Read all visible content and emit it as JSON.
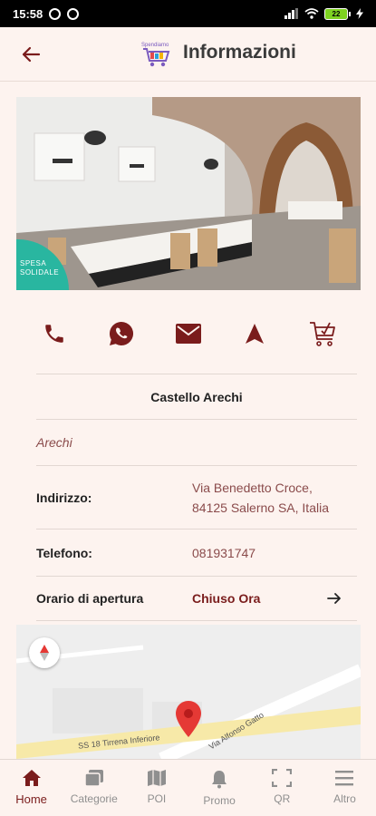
{
  "status_bar": {
    "time": "15:58",
    "battery": "22"
  },
  "app_bar": {
    "title": "Informazioni",
    "logo_text": "Spendiamo"
  },
  "hero": {
    "badge_line1": "SPESA",
    "badge_line2": "SOLIDALE"
  },
  "actions": [
    {
      "icon": "phone-icon"
    },
    {
      "icon": "whatsapp-icon"
    },
    {
      "icon": "email-icon"
    },
    {
      "icon": "navigation-icon"
    },
    {
      "icon": "shopping-cart-icon"
    }
  ],
  "place": {
    "name": "Castello Arechi",
    "city": "Arechi",
    "address_label": "Indirizzo:",
    "address_line1": "Via Benedetto Croce,",
    "address_line2": "84125 Salerno SA, Italia",
    "phone_label": "Telefono:",
    "phone_value": "081931747",
    "hours_label": "Orario di apertura",
    "hours_value": "Chiuso Ora"
  },
  "map": {
    "road_1": "SS 18 Tirrena Inferiore",
    "road_2": "Via Alfonso Gatto"
  },
  "nav": [
    {
      "label": "Home",
      "icon": "home-icon",
      "active": true
    },
    {
      "label": "Categorie",
      "icon": "categories-icon"
    },
    {
      "label": "POI",
      "icon": "map-icon"
    },
    {
      "label": "Promo",
      "icon": "bell-icon"
    },
    {
      "label": "QR",
      "icon": "qr-scan-icon"
    },
    {
      "label": "Altro",
      "icon": "menu-icon"
    }
  ],
  "colors": {
    "accent": "#7a1c1c",
    "background": "#fdf3ef",
    "badge": "#29b6a0",
    "text_muted": "#8a4b4b"
  }
}
